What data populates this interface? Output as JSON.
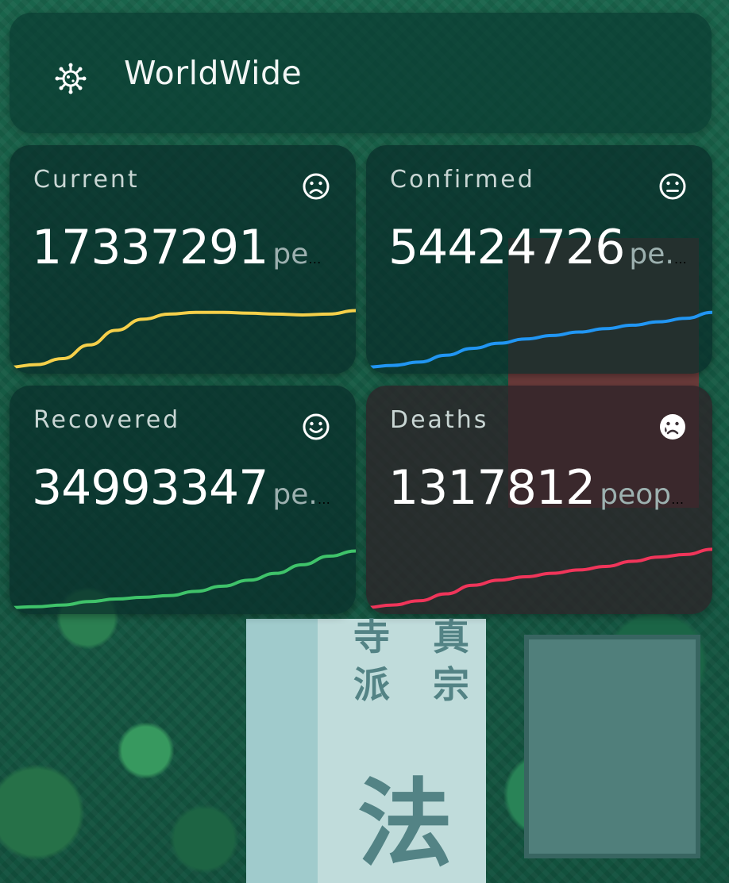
{
  "header": {
    "icon": "virus-icon",
    "title": "WorldWide"
  },
  "cards": [
    {
      "id": "current",
      "label": "Current",
      "value": "17337291",
      "unit": "peop...",
      "face": "sad-face-icon",
      "line_color": "#f5d04a",
      "trend": [
        0.02,
        0.05,
        0.12,
        0.28,
        0.45,
        0.58,
        0.64,
        0.66,
        0.66,
        0.65,
        0.64,
        0.63,
        0.64,
        0.68
      ]
    },
    {
      "id": "confirmed",
      "label": "Confirmed",
      "value": "54424726",
      "unit": "pe...",
      "face": "neutral-face-icon",
      "line_color": "#2196f3",
      "trend": [
        0.02,
        0.04,
        0.08,
        0.16,
        0.24,
        0.3,
        0.35,
        0.39,
        0.43,
        0.47,
        0.51,
        0.55,
        0.59,
        0.66
      ]
    },
    {
      "id": "recovered",
      "label": "Recovered",
      "value": "34993347",
      "unit": "pe...",
      "face": "smile-face-icon",
      "line_color": "#3fc36a",
      "trend": [
        0.02,
        0.03,
        0.05,
        0.09,
        0.12,
        0.14,
        0.16,
        0.21,
        0.27,
        0.34,
        0.42,
        0.52,
        0.62,
        0.68
      ]
    },
    {
      "id": "deaths",
      "label": "Deaths",
      "value": "1317812",
      "unit": "people",
      "face": "crying-face-icon",
      "line_color": "#f0355a",
      "trend": [
        0.02,
        0.05,
        0.1,
        0.18,
        0.28,
        0.34,
        0.38,
        0.42,
        0.46,
        0.5,
        0.56,
        0.61,
        0.64,
        0.7
      ]
    }
  ]
}
